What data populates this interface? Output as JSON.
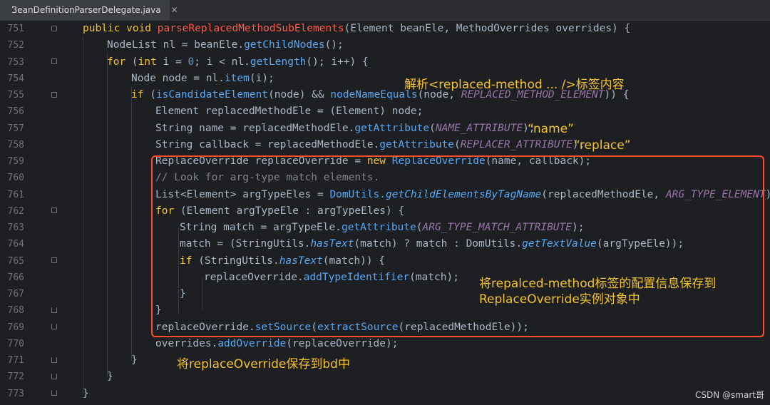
{
  "tab": {
    "title": "BeanDefinitionParserDelegate.java",
    "close": "✕"
  },
  "line_numbers": [
    "751",
    "752",
    "753",
    "754",
    "755",
    "756",
    "757",
    "758",
    "759",
    "760",
    "761",
    "762",
    "763",
    "764",
    "765",
    "766",
    "767",
    "768",
    "769",
    "770",
    "771",
    "772",
    "773"
  ],
  "code": {
    "l751": [
      "public void ",
      "parseReplacedMethodSubElements",
      "(Element beanEle, MethodOverrides overrides) {"
    ],
    "l752": [
      "NodeList nl = beanEle.",
      "getChildNodes",
      "();"
    ],
    "l753": [
      "for",
      " (",
      "int",
      " i = ",
      "0",
      "; i < nl.",
      "getLength",
      "(); i++) {"
    ],
    "l754": [
      "Node node = nl.",
      "item",
      "(i);"
    ],
    "l755": [
      "if",
      " (",
      "isCandidateElement",
      "(node) && ",
      "nodeNameEquals",
      "(node, ",
      "REPLACED_METHOD_ELEMENT",
      ")) {"
    ],
    "l756": [
      "Element replacedMethodEle = (Element) node;"
    ],
    "l757": [
      "String name = replacedMethodEle.",
      "getAttribute",
      "(",
      "NAME_ATTRIBUTE",
      ");"
    ],
    "l758": [
      "String callback = replacedMethodEle.",
      "getAttribute",
      "(",
      "REPLACER_ATTRIBUTE",
      ");"
    ],
    "l759": [
      "ReplaceOverride replaceOverride = ",
      "new",
      " ",
      "ReplaceOverride",
      "(name, callback);"
    ],
    "l760": [
      "// Look for arg-type match elements."
    ],
    "l761": [
      "List<Element> argTypeEles = ",
      "DomUtils.",
      "getChildElementsByTagName",
      "(replacedMethodEle, ",
      "ARG_TYPE_ELEMENT",
      ");"
    ],
    "l762": [
      "for",
      " (Element argTypeEle : argTypeEles) {"
    ],
    "l763": [
      "String match = argTypeEle.",
      "getAttribute",
      "(",
      "ARG_TYPE_MATCH_ATTRIBUTE",
      ");"
    ],
    "l764": [
      "match = (StringUtils.",
      "hasText",
      "(match) ? match : DomUtils.",
      "getTextValue",
      "(argTypeEle));"
    ],
    "l765": [
      "if",
      " (StringUtils.",
      "hasText",
      "(match)) {"
    ],
    "l766": [
      "replaceOverride.",
      "addTypeIdentifier",
      "(match);"
    ],
    "l767": [
      "}"
    ],
    "l768": [
      "}"
    ],
    "l769": [
      "replaceOverride.",
      "setSource",
      "(",
      "extractSource",
      "(replacedMethodEle));"
    ],
    "l770": [
      "overrides.",
      "addOverride",
      "(replaceOverride);"
    ],
    "l771": [
      "}"
    ],
    "l772": [
      "}"
    ],
    "l773": [
      "}"
    ]
  },
  "annotations": {
    "parse_replaced": "解析<replaced-method ... />标签内容",
    "name_q": "“name”",
    "replace_q": "“replace”",
    "save_line1": "将repalced-method标签的配置信息保存到",
    "save_line2": "ReplaceOverride实例对象中",
    "save_bd": "将replaceOverride保存到bd中"
  },
  "watermark": "CSDN @smart哥",
  "colors": {
    "background": "#1e1f22",
    "keyword": "#f2c230",
    "method": "#56a8f5",
    "constant": "#9876aa",
    "highlight": "#ff4d2e",
    "annotation": "#f2c230"
  }
}
